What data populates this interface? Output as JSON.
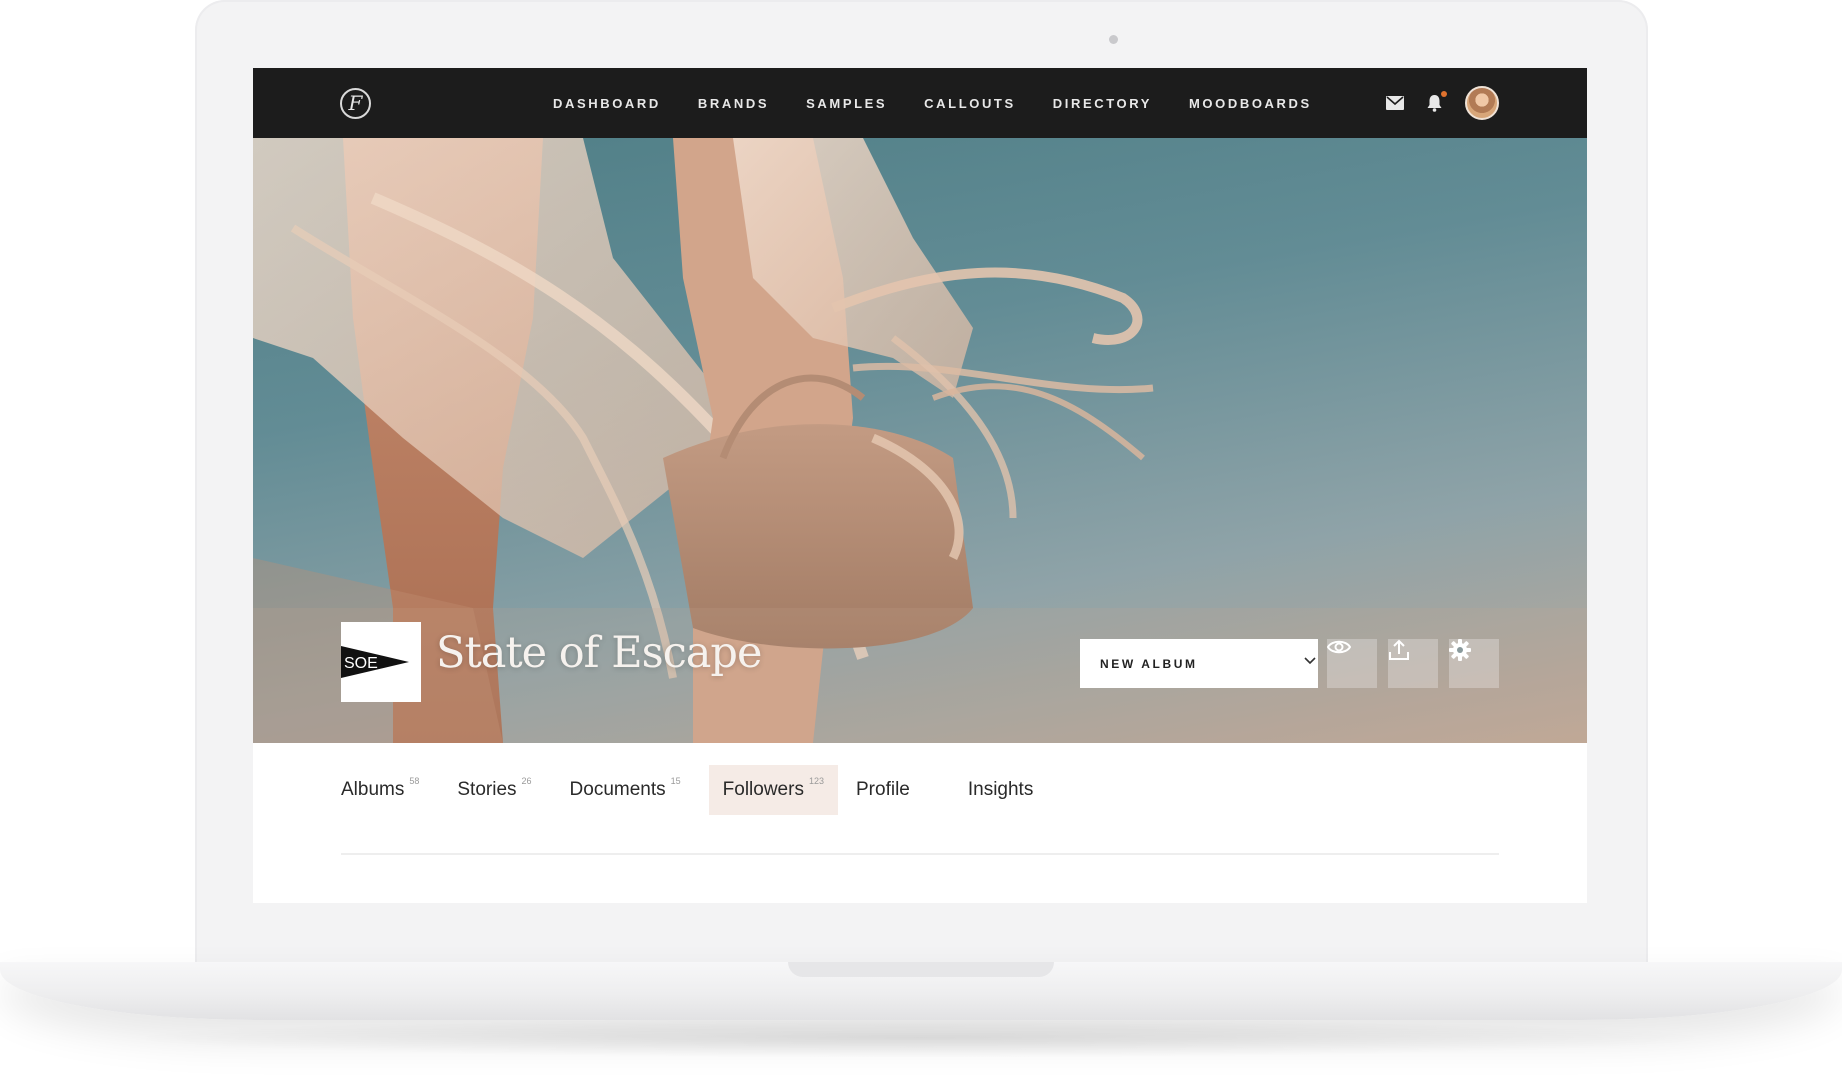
{
  "app": {
    "logo_glyph": "F",
    "nav": [
      {
        "label": "DASHBOARD"
      },
      {
        "label": "BRANDS"
      },
      {
        "label": "SAMPLES"
      },
      {
        "label": "CALLOUTS"
      },
      {
        "label": "DIRECTORY"
      },
      {
        "label": "MOODBOARDS"
      }
    ],
    "icons": [
      "mail-icon",
      "bell-icon",
      "user-avatar"
    ],
    "notification_dot_color": "#e0722e"
  },
  "brand": {
    "logo_text": "SOE",
    "name": "State of Escape"
  },
  "hero_actions": {
    "album_select_value": "NEW ALBUM",
    "buttons": [
      "eye-icon",
      "upload-icon",
      "gear-icon"
    ]
  },
  "tabs": [
    {
      "label": "Albums",
      "count": "58"
    },
    {
      "label": "Stories",
      "count": "26"
    },
    {
      "label": "Documents",
      "count": "15"
    },
    {
      "label": "Followers",
      "count": "123"
    },
    {
      "label": "Profile",
      "count": ""
    },
    {
      "label": "Insights",
      "count": ""
    }
  ],
  "active_tab": "Followers",
  "colors": {
    "nav_bg": "#1c1c1c",
    "active_tab_bg": "#f5ebe6",
    "sky": "#5a8790"
  }
}
